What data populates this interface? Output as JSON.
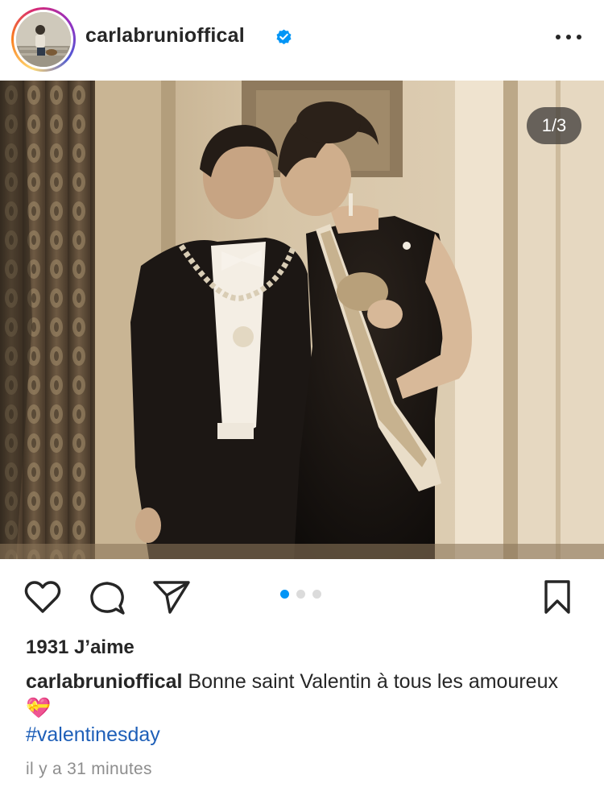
{
  "header": {
    "username": "carlabrunioffical",
    "verified_icon": "verified-badge-icon",
    "more_icon": "more-options-icon"
  },
  "post": {
    "carousel_counter": "1/3",
    "carousel": {
      "current_index": 1,
      "total": 3
    },
    "actions": {
      "like_icon": "heart-icon",
      "comment_icon": "comment-icon",
      "share_icon": "send-icon",
      "save_icon": "bookmark-icon"
    },
    "likes_text": "1931 J’aime",
    "caption": {
      "username": "carlabrunioffical",
      "text": " Bonne saint Valentin à tous les amoureux ",
      "emoji": "💝"
    },
    "hashtag": "#valentinesday",
    "timestamp": "il y a 31 minutes"
  },
  "colors": {
    "accent_blue": "#0095f6",
    "hashtag_blue": "#1e5fb8",
    "text": "#262626",
    "muted": "#8e8e8e"
  }
}
